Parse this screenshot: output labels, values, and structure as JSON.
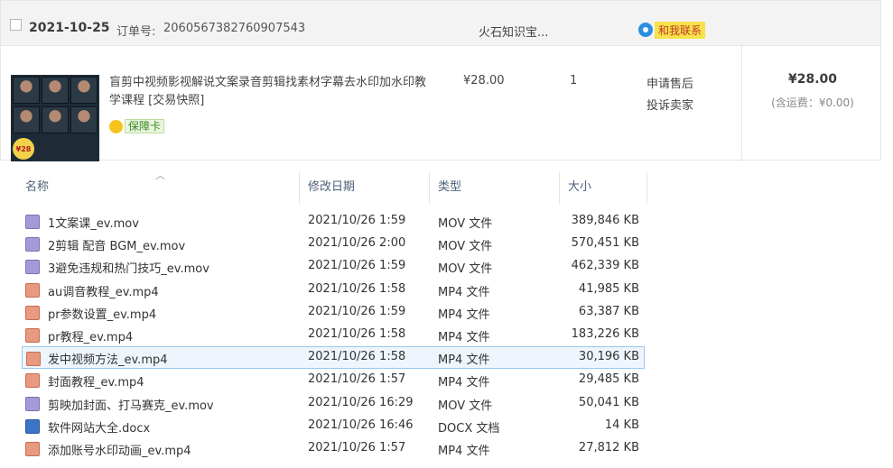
{
  "order": {
    "date": "2021-10-25",
    "order_number_label": "订单号:",
    "order_number": "2060567382760907543",
    "shop_name": "火石知识宝...",
    "contact_label": "和我联系",
    "item": {
      "title": "盲剪中视频影视解说文案录音剪辑找素材字幕去水印加水印教学课程 [交易快照]",
      "guarantee_label": "保障卡",
      "thumbnail_price": "¥28",
      "unit_price": "¥28.00",
      "quantity": "1",
      "action_after_sale": "申请售后",
      "action_complain": "投诉卖家",
      "total": "¥28.00",
      "shipping": "(含运费：¥0.00)"
    }
  },
  "file_list": {
    "columns": {
      "name": "名称",
      "date": "修改日期",
      "type": "类型",
      "size": "大小"
    },
    "files": [
      {
        "name": "1文案课_ev.mov",
        "date": "2021/10/26 1:59",
        "type": "MOV 文件",
        "size": "389,846 KB",
        "kind": "mov",
        "selected": false
      },
      {
        "name": "2剪辑 配音 BGM_ev.mov",
        "date": "2021/10/26 2:00",
        "type": "MOV 文件",
        "size": "570,451 KB",
        "kind": "mov",
        "selected": false
      },
      {
        "name": "3避免违规和热门技巧_ev.mov",
        "date": "2021/10/26 1:59",
        "type": "MOV 文件",
        "size": "462,339 KB",
        "kind": "mov",
        "selected": false
      },
      {
        "name": "au调音教程_ev.mp4",
        "date": "2021/10/26 1:58",
        "type": "MP4 文件",
        "size": "41,985 KB",
        "kind": "mp4",
        "selected": false
      },
      {
        "name": "pr参数设置_ev.mp4",
        "date": "2021/10/26 1:59",
        "type": "MP4 文件",
        "size": "63,387 KB",
        "kind": "mp4",
        "selected": false
      },
      {
        "name": "pr教程_ev.mp4",
        "date": "2021/10/26 1:58",
        "type": "MP4 文件",
        "size": "183,226 KB",
        "kind": "mp4",
        "selected": false
      },
      {
        "name": "发中视频方法_ev.mp4",
        "date": "2021/10/26 1:58",
        "type": "MP4 文件",
        "size": "30,196 KB",
        "kind": "mp4",
        "selected": true
      },
      {
        "name": "封面教程_ev.mp4",
        "date": "2021/10/26 1:57",
        "type": "MP4 文件",
        "size": "29,485 KB",
        "kind": "mp4",
        "selected": false
      },
      {
        "name": "剪映加封面、打马赛克_ev.mov",
        "date": "2021/10/26 16:29",
        "type": "MOV 文件",
        "size": "50,041 KB",
        "kind": "mov",
        "selected": false
      },
      {
        "name": "软件网站大全.docx",
        "date": "2021/10/26 16:46",
        "type": "DOCX 文档",
        "size": "14 KB",
        "kind": "docx",
        "selected": false
      },
      {
        "name": "添加账号水印动画_ev.mp4",
        "date": "2021/10/26 1:57",
        "type": "MP4 文件",
        "size": "27,812 KB",
        "kind": "mp4",
        "selected": false
      }
    ]
  }
}
